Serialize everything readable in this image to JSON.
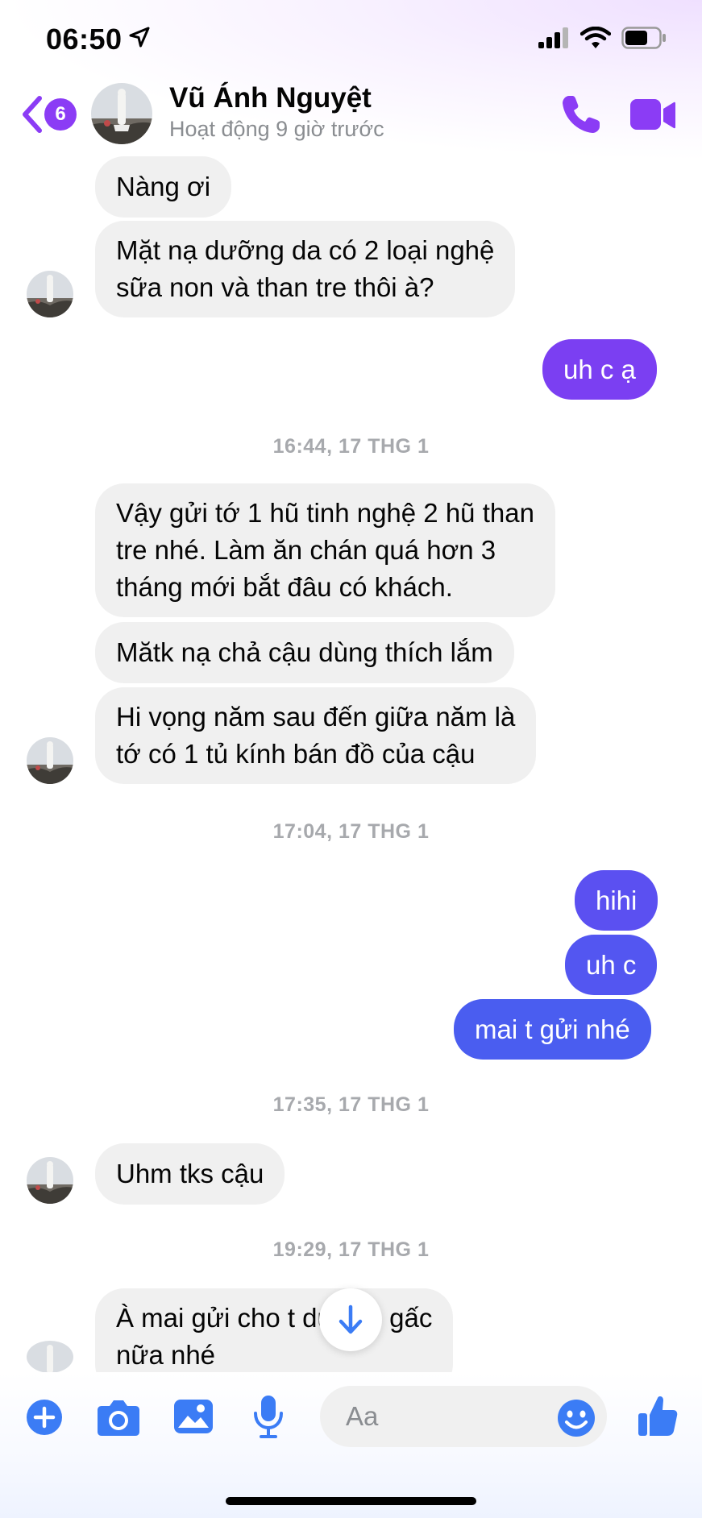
{
  "status": {
    "time": "06:50"
  },
  "header": {
    "back_badge": "6",
    "contact_name": "Vũ Ánh Nguyệt",
    "active_status": "Hoạt động 9 giờ trước"
  },
  "colors": {
    "accent": "#8b3cf5",
    "outgoing_purple": "#7b3ff2",
    "outgoing_blue": "#4a5df0",
    "incoming": "#f0f0f0",
    "composer_icons": "#3b7cf5"
  },
  "messages": [
    {
      "side": "in",
      "text": "Nàng ơi"
    },
    {
      "side": "in",
      "text": "Mặt nạ dưỡng da có 2 loại nghệ\nsữa non và than tre thôi à?"
    },
    {
      "side": "out",
      "text": "uh c ạ"
    },
    {
      "side": "in",
      "text": "Vậy gửi tớ 1 hũ tinh nghệ 2 hũ than\ntre nhé. Làm ăn chán quá hơn 3\ntháng mới bắt đâu có khách."
    },
    {
      "side": "in",
      "text": "Mătk nạ chả cậu dùng thích lắm"
    },
    {
      "side": "in",
      "text": "Hi vọng năm sau đến giữa năm là\ntớ có 1 tủ kính bán đồ của cậu"
    },
    {
      "side": "out",
      "text": "hihi"
    },
    {
      "side": "out",
      "text": "uh c"
    },
    {
      "side": "out",
      "text": "mai t gửi nhé"
    },
    {
      "side": "in",
      "text": "Uhm tks cậu"
    },
    {
      "side": "in",
      "text": "À mai gửi cho t     dưỡng gấc\nnữa nhé"
    }
  ],
  "timestamps": [
    "16:44, 17 THG 1",
    "17:04, 17 THG 1",
    "17:35, 17 THG 1",
    "19:29, 17 THG 1"
  ],
  "composer": {
    "placeholder": "Aa",
    "icons": [
      "plus-icon",
      "camera-icon",
      "image-icon",
      "microphone-icon",
      "emoji-icon",
      "thumbs-up-icon"
    ]
  }
}
